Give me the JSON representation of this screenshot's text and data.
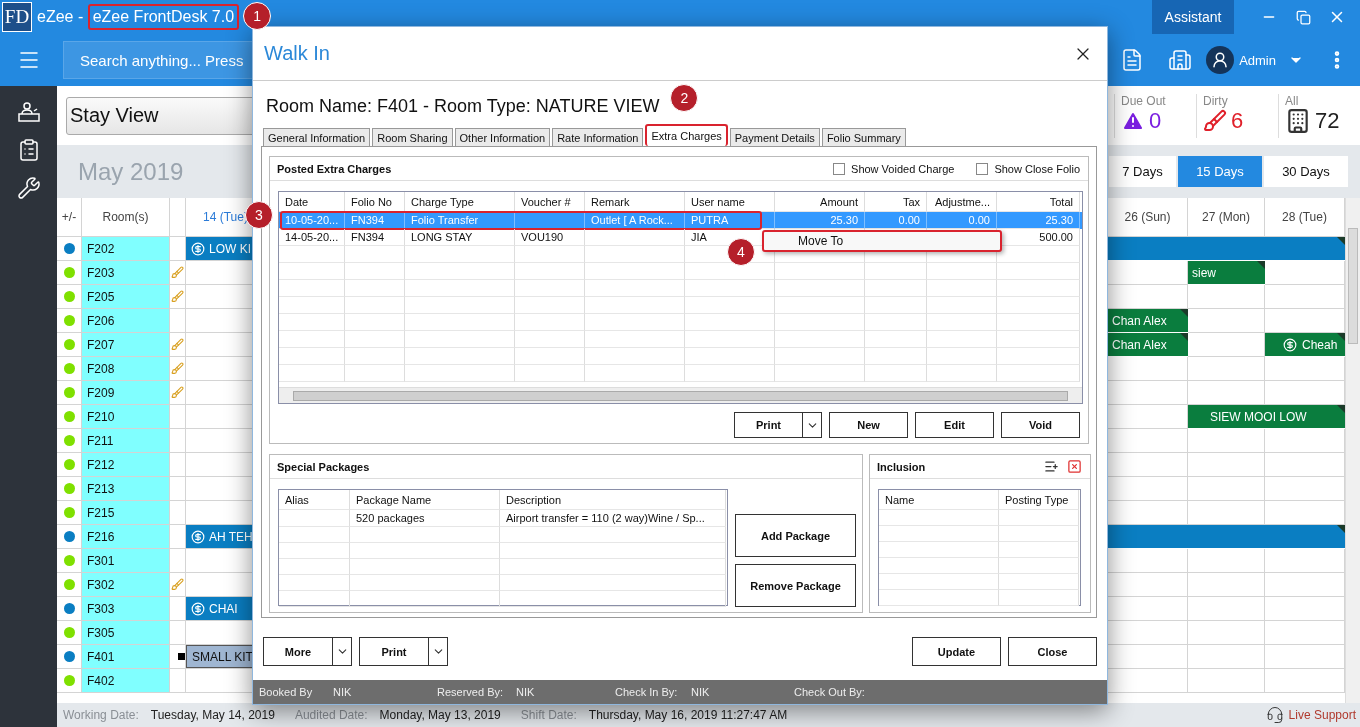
{
  "app": {
    "logo": "FD",
    "title_prefix": "eZee - ",
    "title": "eZee FrontDesk 7.0",
    "title_annotated": true,
    "title_callout": "1",
    "assistant": "Assistant"
  },
  "toolbar": {
    "search_placeholder": "Search anything... Press",
    "user": "Admin"
  },
  "view_selector": {
    "value": "Stay View"
  },
  "stats": [
    {
      "label": "Due Out",
      "value": "0",
      "kind": "due_out"
    },
    {
      "label": "Dirty",
      "value": "6",
      "kind": "dirty"
    },
    {
      "label": "All",
      "value": "72",
      "kind": "all"
    }
  ],
  "calendar": {
    "month": "May 2019",
    "ranges": [
      {
        "label": "7 Days",
        "selected": false
      },
      {
        "label": "15 Days",
        "selected": true
      },
      {
        "label": "30 Days",
        "selected": false
      }
    ],
    "columns": {
      "toggle": "+/-",
      "room": "Room(s)",
      "first_day": "14 (Tue)",
      "days": [
        "26 (Sun)",
        "27 (Mon)",
        "28 (Tue)"
      ]
    },
    "rows": [
      {
        "room": "F202",
        "color": "#0a7ec2",
        "dirty": false,
        "left": {
          "kind": "booking",
          "label": "LOW KI",
          "paid": true,
          "color": "#0a7ec2"
        },
        "right": [
          {
            "kind": "band",
            "color": "#0a7ec2"
          }
        ]
      },
      {
        "room": "F203",
        "color": "#7fe000",
        "dirty": true,
        "right": [
          {
            "kind": "empty"
          },
          {
            "kind": "booking",
            "label": "siew",
            "color": "#0a7d3e"
          },
          {
            "kind": "empty"
          }
        ]
      },
      {
        "room": "F205",
        "color": "#7fe000",
        "dirty": true
      },
      {
        "room": "F206",
        "color": "#7fe000",
        "dirty": false,
        "right": [
          {
            "kind": "booking",
            "label": "Chan Alex",
            "color": "#0a7d3e"
          },
          {
            "kind": "empty"
          },
          {
            "kind": "empty"
          }
        ]
      },
      {
        "room": "F207",
        "color": "#7fe000",
        "dirty": true,
        "right": [
          {
            "kind": "booking",
            "label": "Chan Alex",
            "color": "#0a7d3e"
          },
          {
            "kind": "empty"
          },
          {
            "kind": "booking",
            "label": "Cheah",
            "paid": true,
            "color": "#0a7d3e"
          }
        ]
      },
      {
        "room": "F208",
        "color": "#7fe000",
        "dirty": true
      },
      {
        "room": "F209",
        "color": "#7fe000",
        "dirty": true
      },
      {
        "room": "F210",
        "color": "#7fe000",
        "dirty": false,
        "right": [
          {
            "kind": "empty"
          },
          {
            "kind": "booking",
            "double": true,
            "label": "SIEW MOOI LOW",
            "color": "#0a7d3e"
          }
        ]
      },
      {
        "room": "F211",
        "color": "#7fe000",
        "dirty": false
      },
      {
        "room": "F212",
        "color": "#7fe000",
        "dirty": false
      },
      {
        "room": "F213",
        "color": "#7fe000",
        "dirty": false
      },
      {
        "room": "F215",
        "color": "#7fe000",
        "dirty": false
      },
      {
        "room": "F216",
        "color": "#0a7ec2",
        "dirty": false,
        "left": {
          "kind": "booking",
          "label": "AH TEH",
          "paid": true,
          "color": "#0a7ec2"
        },
        "right": [
          {
            "kind": "band",
            "color": "#0a7ec2"
          }
        ]
      },
      {
        "room": "F301",
        "color": "#7fe000",
        "dirty": false
      },
      {
        "room": "F302",
        "color": "#7fe000",
        "dirty": true
      },
      {
        "room": "F303",
        "color": "#0a7ec2",
        "dirty": false,
        "left": {
          "kind": "booking",
          "label": "CHAI",
          "paid": true,
          "color": "#0a7ec2"
        }
      },
      {
        "room": "F305",
        "color": "#7fe000",
        "dirty": false
      },
      {
        "room": "F401",
        "color": "#0a7ec2",
        "dirty": false,
        "left": {
          "kind": "block",
          "label": "SMALL KIT",
          "paid": false,
          "color": "#9fb6d2"
        }
      },
      {
        "room": "F402",
        "color": "#7fe000",
        "dirty": false
      }
    ]
  },
  "status_bar": [
    {
      "label": "Working Date:",
      "value": "Tuesday, May 14, 2019"
    },
    {
      "label": "Audited Date:",
      "value": "Monday, May 13, 2019"
    },
    {
      "label": "Shift Date:",
      "value": "Thursday, May 16, 2019 11:27:47 AM"
    }
  ],
  "support": "Live Support",
  "dialog": {
    "title": "Walk In",
    "heading": "Room Name: F401 - Room Type: NATURE VIEW",
    "tabs": [
      {
        "label": "General Information",
        "selected": false,
        "annotated": false
      },
      {
        "label": "Room Sharing",
        "selected": false,
        "annotated": false
      },
      {
        "label": "Other Information",
        "selected": false,
        "annotated": false
      },
      {
        "label": "Rate Information",
        "selected": false,
        "annotated": false
      },
      {
        "label": "Extra Charges",
        "selected": true,
        "annotated": true,
        "callout": "2"
      },
      {
        "label": "Payment Details",
        "selected": false,
        "annotated": false
      },
      {
        "label": "Folio Summary",
        "selected": false,
        "annotated": false
      }
    ],
    "extra_charges": {
      "title": "Posted Extra Charges",
      "options": [
        {
          "label": "Show Voided Charge",
          "checked": false
        },
        {
          "label": "Show Close Folio",
          "checked": false
        }
      ],
      "columns": [
        "Date",
        "Folio No",
        "Charge Type",
        "Voucher #",
        "Remark",
        "User name",
        "Amount",
        "Tax",
        "Adjustme...",
        "Total"
      ],
      "rows": [
        {
          "selected": true,
          "annotated": true,
          "callout": "3",
          "date": "10-05-20...",
          "folio_no": "FN394",
          "charge_type": "Folio Transfer",
          "remark": "Outlet [ A Rock...",
          "user_name": "PUTRA",
          "amount": "25.30",
          "tax": "0.00",
          "adjustment": "0.00",
          "total": "25.30"
        },
        {
          "selected": false,
          "date": "14-05-20...",
          "folio_no": "FN394",
          "charge_type": "LONG STAY",
          "voucher": "VOU190",
          "user_name": "JIA",
          "total": "500.00"
        }
      ],
      "context_menu": {
        "item": "Move To",
        "annotated": true,
        "callout": "4"
      },
      "buttons": [
        {
          "label": "Print",
          "kind": "split"
        },
        {
          "label": "New",
          "kind": "plain"
        },
        {
          "label": "Edit",
          "kind": "plain"
        },
        {
          "label": "Void",
          "kind": "plain"
        }
      ]
    },
    "packages": {
      "title": "Special Packages",
      "columns": [
        "Alias",
        "Package Name",
        "Description"
      ],
      "rows": [
        {
          "package_name": "520 packages",
          "description": "Airport transfer = 110 (2 way)Wine / Sp..."
        }
      ],
      "buttons": [
        "Add Package",
        "Remove Package"
      ]
    },
    "inclusion": {
      "title": "Inclusion",
      "columns": [
        "Name",
        "Posting Type"
      ]
    },
    "actions_left": [
      {
        "label": "More",
        "kind": "split"
      },
      {
        "label": "Print",
        "kind": "split"
      }
    ],
    "actions_right": [
      {
        "label": "Update",
        "kind": "plain"
      },
      {
        "label": "Close",
        "kind": "plain"
      }
    ],
    "info": [
      {
        "label": "Booked By",
        "value": "NIK"
      },
      {
        "label": "Reserved By:",
        "value": "NIK"
      },
      {
        "label": "Check In By:",
        "value": "NIK"
      },
      {
        "label": "Check Out By:"
      }
    ]
  }
}
